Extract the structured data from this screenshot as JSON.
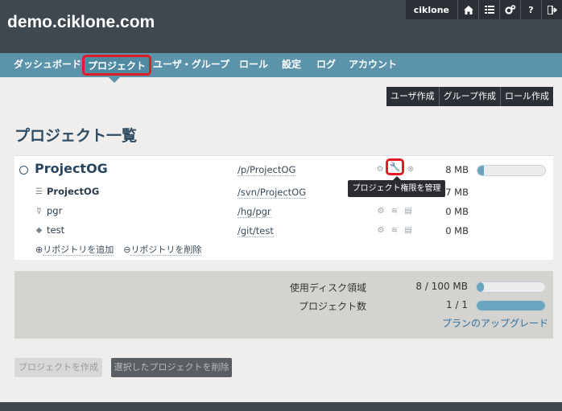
{
  "site": {
    "title": "demo.ciklone.com"
  },
  "topbar": {
    "user": "ciklone",
    "icons": [
      "home-icon",
      "list-icon",
      "gears-icon",
      "help-icon",
      "logout-icon"
    ]
  },
  "nav": {
    "items": [
      "ダッシュボード",
      "プロジェクト",
      "ユーザ・グループ",
      "ロール",
      "設定",
      "ログ",
      "アカウント"
    ],
    "active": "プロジェクト"
  },
  "actions": {
    "create_user": "ユーザ作成",
    "create_group": "グループ作成",
    "create_role": "ロール作成"
  },
  "page": {
    "title": "プロジェクト一覧"
  },
  "project": {
    "name": "ProjectOG",
    "path": "/p/ProjectOG",
    "size": "8 MB",
    "usage_fraction": 0.08,
    "tooltip": "プロジェクト権限を管理",
    "repos": [
      {
        "name": "ProjectOG",
        "path": "/svn/ProjectOG",
        "size": "7 MB",
        "type": "svn"
      },
      {
        "name": "pgr",
        "path": "/hg/pgr",
        "size": "0 MB",
        "type": "hg"
      },
      {
        "name": "test",
        "path": "/git/test",
        "size": "0 MB",
        "type": "git"
      }
    ],
    "add_repo": "リポジトリを追加",
    "remove_repo": "リポジトリを削除"
  },
  "usage": {
    "disk_label": "使用ディスク領域",
    "disk_value": "8 / 100 MB",
    "disk_fraction": 0.08,
    "projects_label": "プロジェクト数",
    "projects_value": "1 / 1",
    "projects_fraction": 1.0,
    "upgrade_link": "プランのアップグレード"
  },
  "buttons": {
    "create_project": "プロジェクトを作成",
    "delete_selected": "選択したプロジェクトを削除"
  },
  "colors": {
    "header": "#3f474f",
    "nav": "#5a93aa",
    "highlight": "#e21c26",
    "bar_fill": "#6aa5c0"
  }
}
